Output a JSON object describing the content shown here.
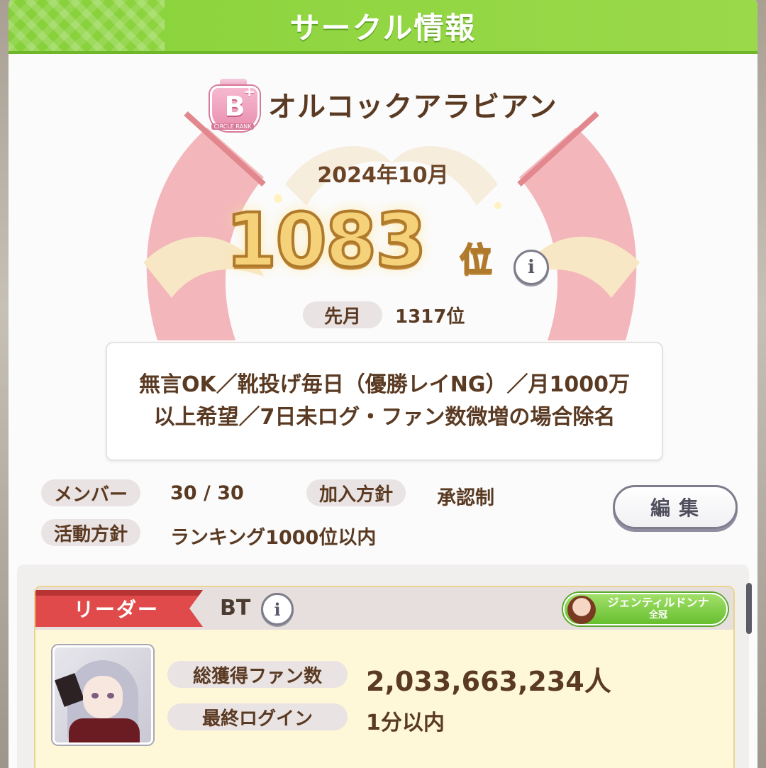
{
  "header": {
    "title": "サークル情報"
  },
  "circle": {
    "rank_badge": {
      "letter": "B",
      "modifier": "+",
      "caption": "CIRCLE RANK",
      "color": "#e88fae"
    },
    "name": "オルコックアラビアン",
    "ranking_month": "2024年10月",
    "rank_number": "1083",
    "rank_suffix": "位",
    "previous": {
      "label": "先月",
      "value": "1317位"
    },
    "comment": "無言OK／靴投げ毎日（優勝レイNG）／月1000万以上希望／7日未ログ・ファン数微増の場合除名",
    "members": {
      "label": "メンバー",
      "value": "30 / 30"
    },
    "join_policy": {
      "label": "加入方針",
      "value": "承認制"
    },
    "activity_policy": {
      "label": "活動方針",
      "value": "ランキング1000位以内"
    },
    "edit_label": "編集"
  },
  "leader": {
    "tag": "リーダー",
    "name": "BT",
    "title_badge": {
      "line1": "ジェンティルドンナ",
      "line2": "全冠"
    },
    "total_fans": {
      "label": "総獲得ファン数",
      "value": "2,033,663,234人"
    },
    "last_login": {
      "label": "最終ログイン",
      "value": "1分以内"
    }
  },
  "icons": {
    "info": "info-icon",
    "rank": "circle-rank-badge-icon",
    "avatar": "trainee-avatar-icon"
  },
  "colors": {
    "header_green": "#8fd540",
    "accent_red": "#e04a4a",
    "text_brown": "#5a3a22",
    "gold": "#f5d27a"
  }
}
